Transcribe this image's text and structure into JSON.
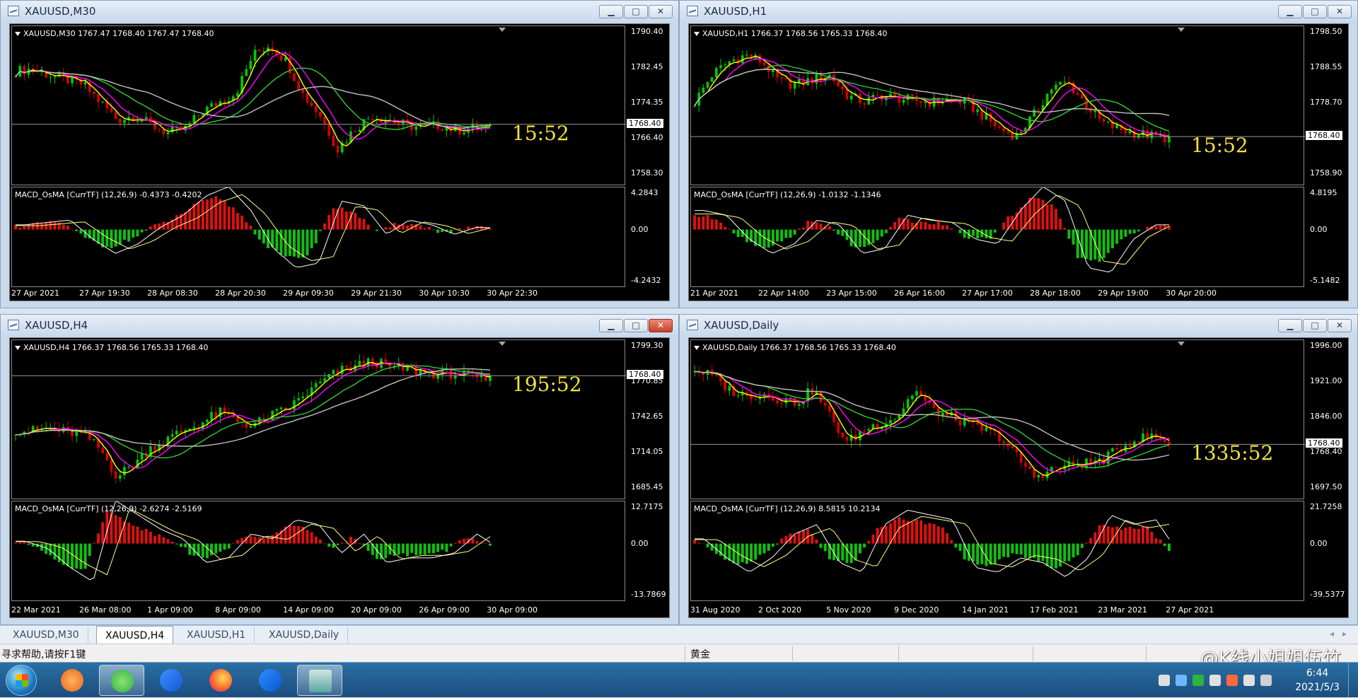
{
  "colors": {
    "bull_candle": "#00c800",
    "bear_candle": "#d40000",
    "ma_fast": "#ffff00",
    "ma_mid": "#ff00ff",
    "ma_slow": "#32cd32",
    "ma_long": "#c0c0c0",
    "histogram_up": "#e01010",
    "histogram_down": "#10c010",
    "macd_line": "#ffffff",
    "signal_line": "#ffff80",
    "countdown": "#f3e33a"
  },
  "windows": [
    {
      "title": "XAUUSD,M30",
      "main_label": "XAUUSD,M30  1767.47 1768.40 1767.47 1768.40",
      "price_ticks": [
        "1790.40",
        "1782.45",
        "1774.35",
        "1766.40",
        "1758.30"
      ],
      "current_price": "1768.40",
      "countdown": "15:52",
      "sub_label": "MACD_OsMA [CurrTF] (12,26,9) -0.4373 -0.4202",
      "sub_ticks": [
        "4.2843",
        "0.00",
        "-4.2432"
      ],
      "time_ticks": [
        "27 Apr 2021",
        "27 Apr 19:30",
        "28 Apr 08:30",
        "28 Apr 20:30",
        "29 Apr 09:30",
        "29 Apr 21:30",
        "30 Apr 10:30",
        "30 Apr 22:30"
      ],
      "close_active": false,
      "close_path": [
        0.78,
        0.8,
        0.75,
        0.72,
        0.68,
        0.55,
        0.42,
        0.45,
        0.38,
        0.32,
        0.35,
        0.48,
        0.55,
        0.62,
        0.9,
        0.98,
        0.85,
        0.6,
        0.45,
        0.2,
        0.35,
        0.45,
        0.42,
        0.38,
        0.36,
        0.38,
        0.34,
        0.36,
        0.35
      ],
      "macd_hist": [
        0.1,
        0.15,
        0.2,
        -0.2,
        -0.5,
        -0.3,
        0.05,
        0.3,
        0.7,
        0.9,
        0.4,
        -0.4,
        -0.8,
        -0.7,
        0.6,
        0.5,
        -0.1,
        0.2,
        0.1,
        -0.1,
        0.05,
        0.03
      ]
    },
    {
      "title": "XAUUSD,H1",
      "main_label": "XAUUSD,H1  1766.37 1768.56 1765.33 1768.40",
      "price_ticks": [
        "1798.50",
        "1788.55",
        "1778.70",
        "1768.40",
        "1758.90"
      ],
      "current_price": "1768.40",
      "countdown": "15:52",
      "sub_label": "MACD_OsMA [CurrTF] (12,26,9) -1.0132 -1.1346",
      "sub_ticks": [
        "4.8195",
        "0.00",
        "-5.1482"
      ],
      "time_ticks": [
        "21 Apr 2021",
        "22 Apr 14:00",
        "23 Apr 15:00",
        "26 Apr 16:00",
        "27 Apr 17:00",
        "28 Apr 18:00",
        "29 Apr 19:00",
        "30 Apr 20:00"
      ],
      "close_active": false,
      "close_path": [
        0.55,
        0.75,
        0.85,
        0.9,
        0.85,
        0.7,
        0.68,
        0.72,
        0.75,
        0.6,
        0.55,
        0.6,
        0.58,
        0.56,
        0.55,
        0.57,
        0.55,
        0.45,
        0.35,
        0.3,
        0.45,
        0.65,
        0.7,
        0.55,
        0.4,
        0.35,
        0.32,
        0.3,
        0.28
      ],
      "macd_hist": [
        0.4,
        0.3,
        -0.2,
        -0.5,
        -0.3,
        0.2,
        0.1,
        -0.5,
        -0.4,
        0.3,
        0.2,
        0.15,
        -0.2,
        -0.3,
        0.4,
        0.9,
        0.6,
        -0.8,
        -0.9,
        -0.2,
        0.1,
        0.1
      ]
    },
    {
      "title": "XAUUSD,H4",
      "main_label": "XAUUSD,H4  1766.37 1768.56 1765.33 1768.40",
      "price_ticks": [
        "1799.30",
        "1770.85",
        "1742.65",
        "1714.05",
        "1685.45"
      ],
      "current_price": "1768.40",
      "countdown": "195:52",
      "sub_label": "MACD_OsMA [CurrTF] (12,26,9) -2.6274 -2.5169",
      "sub_ticks": [
        "12.7175",
        "0.00",
        "-13.7869"
      ],
      "time_ticks": [
        "22 Mar 2021",
        "26 Mar 08:00",
        "1 Apr 09:00",
        "8 Apr 09:00",
        "14 Apr 09:00",
        "20 Apr 09:00",
        "26 Apr 09:00",
        "30 Apr 09:00"
      ],
      "close_active": true,
      "close_path": [
        0.45,
        0.44,
        0.46,
        0.43,
        0.42,
        0.3,
        0.1,
        0.2,
        0.32,
        0.38,
        0.45,
        0.5,
        0.58,
        0.52,
        0.48,
        0.55,
        0.6,
        0.7,
        0.8,
        0.88,
        0.92,
        0.96,
        0.92,
        0.9,
        0.88,
        0.86,
        0.87,
        0.84,
        0.82
      ],
      "macd_hist": [
        0.05,
        -0.1,
        -0.5,
        -0.8,
        0.9,
        0.6,
        0.3,
        0.1,
        -0.4,
        -0.3,
        0.2,
        0.1,
        0.5,
        0.4,
        -0.2,
        0.2,
        -0.4,
        -0.3,
        -0.3,
        -0.2,
        0.2,
        -0.1
      ]
    },
    {
      "title": "XAUUSD,Daily",
      "main_label": "XAUUSD,Daily  1766.37 1768.56 1765.33 1768.40",
      "price_ticks": [
        "1996.00",
        "1921.00",
        "1846.00",
        "1768.40",
        "1697.50"
      ],
      "current_price": "1768.40",
      "countdown": "1335:52",
      "sub_label": "MACD_OsMA [CurrTF] (12,26,9) 8.5815 10.2134",
      "sub_ticks": [
        "21.7258",
        "0.00",
        "-39.5377"
      ],
      "time_ticks": [
        "31 Aug 2020",
        "2 Oct 2020",
        "5 Nov 2020",
        "9 Dec 2020",
        "14 Jan 2021",
        "17 Feb 2021",
        "23 Mar 2021",
        "27 Apr 2021"
      ],
      "close_active": false,
      "close_path": [
        0.9,
        0.85,
        0.75,
        0.7,
        0.72,
        0.68,
        0.65,
        0.75,
        0.55,
        0.35,
        0.45,
        0.5,
        0.55,
        0.75,
        0.6,
        0.55,
        0.5,
        0.45,
        0.4,
        0.25,
        0.1,
        0.15,
        0.18,
        0.2,
        0.22,
        0.3,
        0.38,
        0.4,
        0.36
      ],
      "macd_hist": [
        0.1,
        -0.3,
        -0.6,
        -0.3,
        0.2,
        0.4,
        -0.4,
        -0.6,
        0.4,
        0.7,
        0.6,
        0.5,
        -0.5,
        -0.6,
        -0.3,
        -0.4,
        -0.7,
        -0.3,
        0.6,
        0.4,
        0.5,
        -0.2
      ]
    }
  ],
  "tabs": [
    {
      "label": "XAUUSD,M30",
      "active": false
    },
    {
      "label": "XAUUSD,H4",
      "active": true
    },
    {
      "label": "XAUUSD,H1",
      "active": false
    },
    {
      "label": "XAUUSD,Daily",
      "active": false
    }
  ],
  "status_bar": {
    "help_text": "寻求帮助,请按F1键",
    "symbol_text": "黄金",
    "watermark": "@K线小姐姐伍竹"
  },
  "taskbar": {
    "time": "6:44",
    "date": "2021/5/3"
  }
}
